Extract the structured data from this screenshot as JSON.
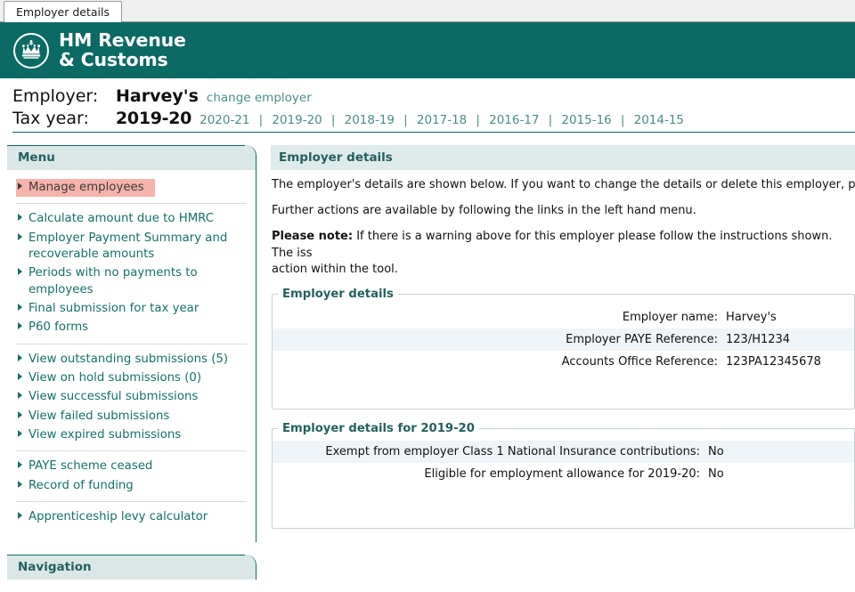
{
  "browser": {
    "tab_label": "Employer details"
  },
  "brand": {
    "line1": "HM Revenue",
    "line2": "& Customs",
    "logo_icon": "hmrc-crown-icon",
    "banner_color": "#0b6a63"
  },
  "header": {
    "employer_label": "Employer:",
    "employer_name": "Harvey's",
    "change_employer_link": "change employer",
    "tax_year_label": "Tax year:",
    "tax_year_value": "2019-20",
    "tax_year_links": [
      "2020-21",
      "2019-20",
      "2018-19",
      "2017-18",
      "2016-17",
      "2015-16",
      "2014-15"
    ],
    "separator": "|",
    "link_color": "#4a8d8a"
  },
  "sidebar": {
    "menu_title": "Menu",
    "navigation_title": "Navigation",
    "highlight_color": "#f5b3ab",
    "groups": [
      {
        "items": [
          {
            "label": "Manage employees",
            "highlighted": true
          }
        ]
      },
      {
        "items": [
          {
            "label": "Calculate amount due to HMRC",
            "highlighted": false
          },
          {
            "label": "Employer Payment Summary and recoverable amounts",
            "highlighted": false
          },
          {
            "label": "Periods with no payments to employees",
            "highlighted": false
          },
          {
            "label": "Final submission for tax year",
            "highlighted": false
          },
          {
            "label": "P60 forms",
            "highlighted": false
          }
        ]
      },
      {
        "items": [
          {
            "label": "View outstanding submissions (5)",
            "highlighted": false
          },
          {
            "label": "View on hold submissions (0)",
            "highlighted": false
          },
          {
            "label": "View successful submissions",
            "highlighted": false
          },
          {
            "label": "View failed submissions",
            "highlighted": false
          },
          {
            "label": "View expired submissions",
            "highlighted": false
          }
        ]
      },
      {
        "items": [
          {
            "label": "PAYE scheme ceased",
            "highlighted": false
          },
          {
            "label": "Record of funding",
            "highlighted": false
          }
        ]
      },
      {
        "items": [
          {
            "label": "Apprenticeship levy calculator",
            "highlighted": false
          }
        ]
      }
    ]
  },
  "main": {
    "panel_title": "Employer details",
    "intro_paragraph": "The employer's details are shown below. If you want to change the details or delete this employer, plea",
    "second_paragraph": "Further actions are available by following the links in the left hand menu.",
    "note_label": "Please note:",
    "note_text": " If there is a warning above for this employer please follow the instructions shown. The iss",
    "note_text_line2": "action within the tool.",
    "employer_details": {
      "legend": "Employer details",
      "rows": [
        {
          "label": "Employer name:",
          "value": "Harvey's"
        },
        {
          "label": "Employer PAYE Reference:",
          "value": "123/H1234"
        },
        {
          "label": "Accounts Office Reference:",
          "value": "123PA12345678"
        }
      ]
    },
    "year_details": {
      "legend": "Employer details for 2019-20",
      "rows": [
        {
          "label": "Exempt from employer Class 1 National Insurance contributions:",
          "value": "No"
        },
        {
          "label": "Eligible for employment allowance for 2019-20:",
          "value": "No"
        }
      ]
    }
  }
}
